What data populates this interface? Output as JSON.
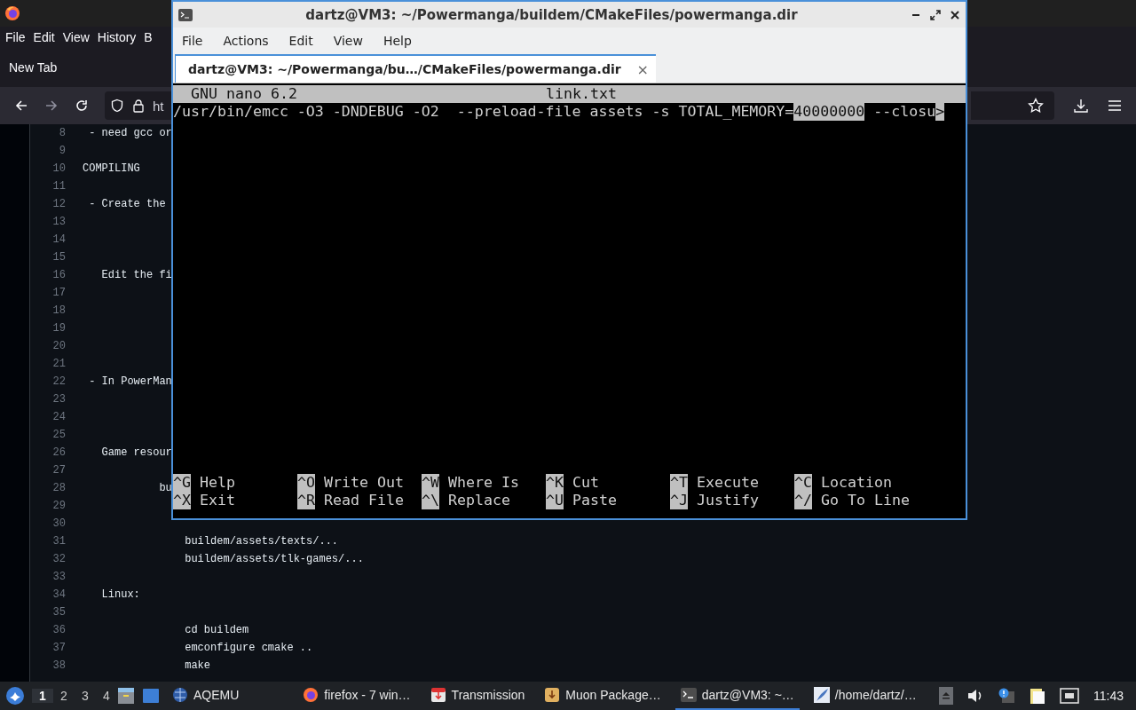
{
  "browser": {
    "menu": [
      {
        "label": "File"
      },
      {
        "label": "Edit"
      },
      {
        "label": "View"
      },
      {
        "label": "History"
      },
      {
        "label": "B"
      }
    ],
    "tab": {
      "label": "New Tab",
      "selected": true
    },
    "url": "ht",
    "source": [
      {
        "number": "8",
        "text": " - need gcc or"
      },
      {
        "number": "9"
      },
      {
        "number": "10",
        "text": "COMPILING"
      },
      {
        "number": "11"
      },
      {
        "number": "12",
        "text": " - Create the"
      },
      {
        "number": "13"
      },
      {
        "number": "14"
      },
      {
        "number": "15"
      },
      {
        "number": "16",
        "text": "   Edit the fi"
      },
      {
        "number": "17"
      },
      {
        "number": "18"
      },
      {
        "number": "19"
      },
      {
        "number": "20"
      },
      {
        "number": "21"
      },
      {
        "number": "22",
        "text": " - In PowerMan"
      },
      {
        "number": "23"
      },
      {
        "number": "24"
      },
      {
        "number": "25"
      },
      {
        "number": "26",
        "text": "   Game resour"
      },
      {
        "number": "27"
      },
      {
        "number": "28",
        "text": "            bu"
      },
      {
        "number": "29"
      },
      {
        "number": "30"
      },
      {
        "number": "31",
        "text": "                buildem/assets/texts/..."
      },
      {
        "number": "32",
        "text": "                buildem/assets/tlk-games/..."
      },
      {
        "number": "33"
      },
      {
        "number": "34",
        "text": "   Linux:"
      },
      {
        "number": "35"
      },
      {
        "number": "36",
        "text": "                cd buildem"
      },
      {
        "number": "37",
        "text": "                emconfigure cmake .."
      },
      {
        "number": "38",
        "text": "                make"
      }
    ]
  },
  "terminal": {
    "title": "dartz@VM3: ~/Powermanga/buildem/CMakeFiles/powermanga.dir",
    "menu": [
      {
        "label": "File"
      },
      {
        "label": "Actions"
      },
      {
        "label": "Edit"
      },
      {
        "label": "View"
      },
      {
        "label": "Help"
      }
    ],
    "tab": {
      "label": "dartz@VM3: ~/Powermanga/bu…/CMakeFiles/powermanga.dir",
      "close": "×",
      "selected": true
    },
    "nano": {
      "version": "GNU nano 6.2",
      "file": "link.txt",
      "line": [
        {
          "text": "/usr/bin/emcc -O3 -DNDEBUG -O2  --preload-file assets -s TOTAL_MEMORY=",
          "highlight": false
        },
        {
          "text": "40000000",
          "highlight": true
        },
        {
          "text": " --closu",
          "highlight": false
        },
        {
          "text": ">",
          "highlight": true
        }
      ],
      "shortcuts": [
        [
          {
            "key": "^G",
            "label": "Help"
          },
          {
            "key": "^O",
            "label": "Write Out"
          },
          {
            "key": "^W",
            "label": "Where Is"
          },
          {
            "key": "^K",
            "label": "Cut"
          },
          {
            "key": "^T",
            "label": "Execute"
          },
          {
            "key": "^C",
            "label": "Location"
          }
        ],
        [
          {
            "key": "^X",
            "label": "Exit"
          },
          {
            "key": "^R",
            "label": "Read File"
          },
          {
            "key": "^\\",
            "label": "Replace"
          },
          {
            "key": "^U",
            "label": "Paste"
          },
          {
            "key": "^J",
            "label": "Justify"
          },
          {
            "key": "^/",
            "label": "Go To Line"
          }
        ]
      ]
    }
  },
  "taskbar": {
    "workspaces": [
      {
        "label": "1",
        "selected": true
      },
      {
        "label": "2",
        "selected": false
      },
      {
        "label": "3",
        "selected": false
      },
      {
        "label": "4",
        "selected": false
      }
    ],
    "launcher": {
      "label": "AQEMU"
    },
    "tasks": [
      {
        "label": "firefox - 7 win…",
        "kind": "firefox",
        "selected": false
      },
      {
        "label": "Transmission",
        "kind": "transmission",
        "selected": false
      },
      {
        "label": "Muon Package…",
        "kind": "package",
        "selected": false
      },
      {
        "label": "dartz@VM3: ~…",
        "kind": "terminal",
        "selected": true
      },
      {
        "label": "/home/dartz/…",
        "kind": "editor",
        "selected": false
      }
    ],
    "clock": "11:43"
  }
}
